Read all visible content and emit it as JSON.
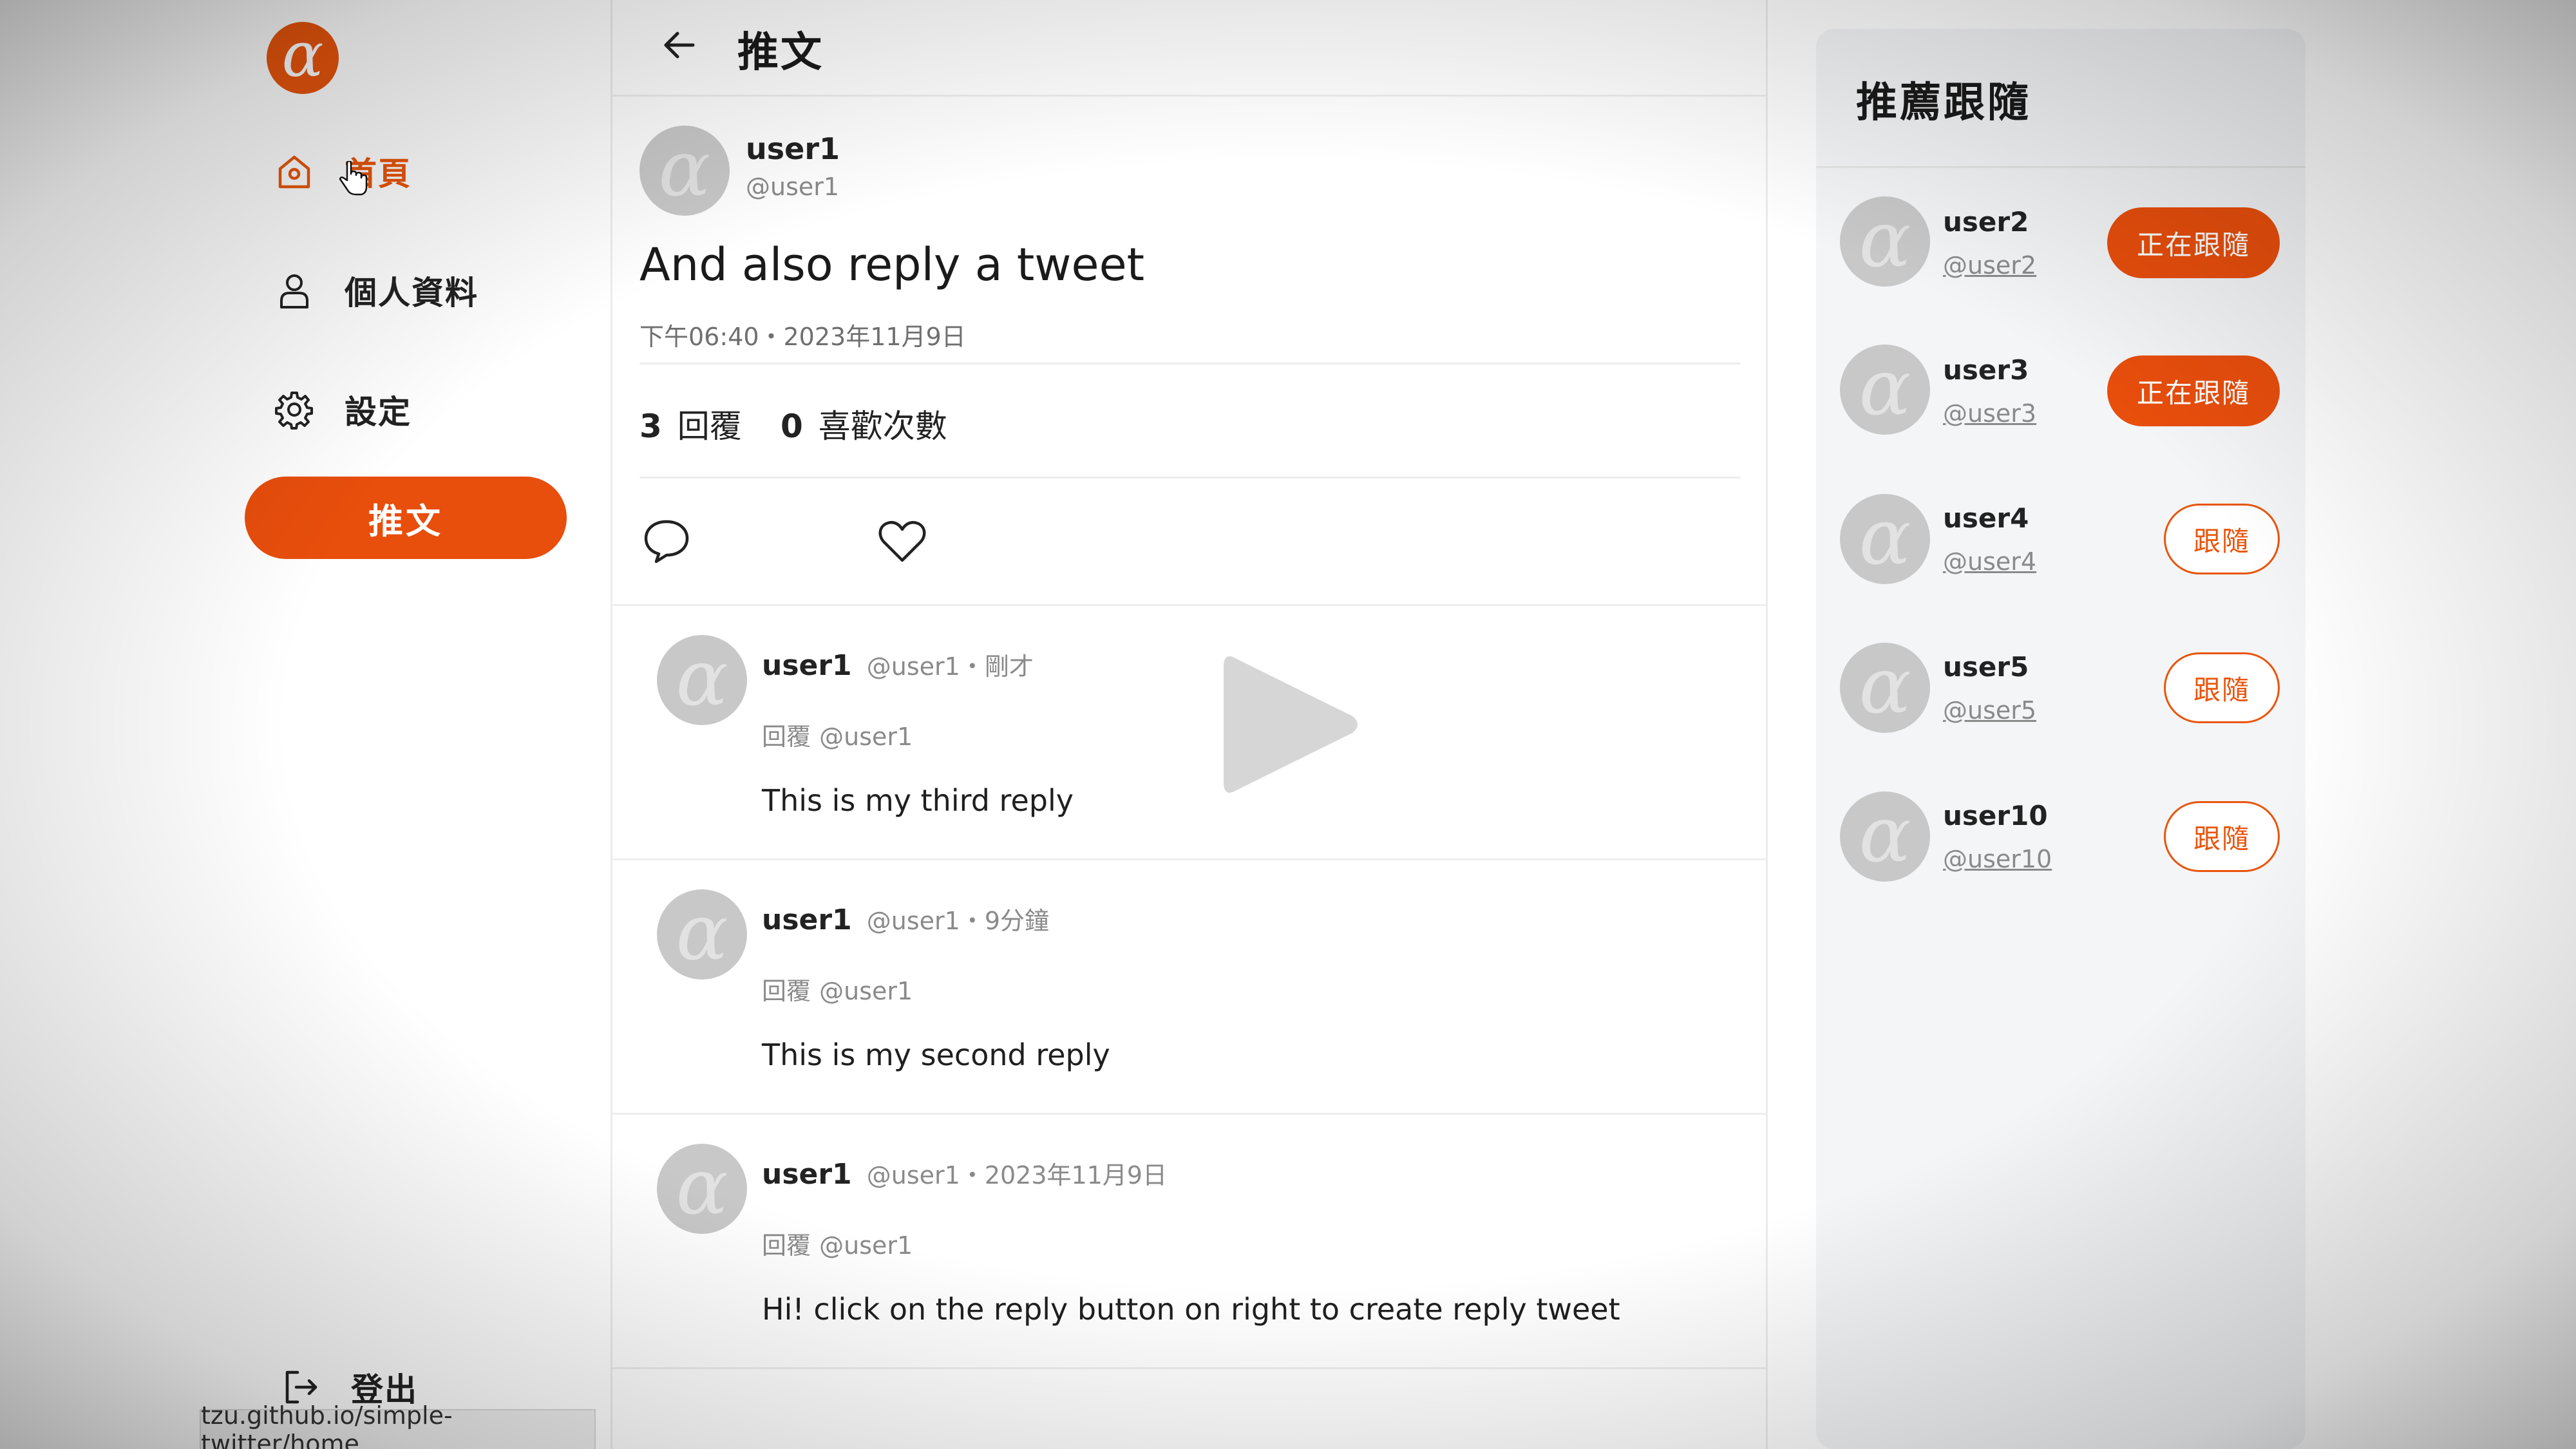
{
  "sidebar": {
    "logo": "alpha-logo-icon",
    "items": [
      {
        "icon": "home-icon",
        "label": "首頁",
        "active": true
      },
      {
        "icon": "user-icon",
        "label": "個人資料",
        "active": false
      },
      {
        "icon": "gear-icon",
        "label": "設定",
        "active": false
      }
    ],
    "tweet_button": "推文",
    "logout": {
      "icon": "logout-icon",
      "label": "登出"
    }
  },
  "header": {
    "back_icon": "arrow-left-icon",
    "title": "推文"
  },
  "tweet": {
    "name": "user1",
    "handle": "@user1",
    "text": "And also reply a tweet",
    "datetime": "下午06:40・2023年11月9日",
    "reply_count": "3",
    "reply_label": "回覆",
    "like_count": "0",
    "like_label": "喜歡次數",
    "reply_icon": "comment-icon",
    "like_icon": "heart-icon"
  },
  "replies": [
    {
      "name": "user1",
      "meta": "@user1・剛才",
      "reply_prefix": "回覆",
      "reply_to": "@user1",
      "text": "This is my third reply"
    },
    {
      "name": "user1",
      "meta": "@user1・9分鐘",
      "reply_prefix": "回覆",
      "reply_to": "@user1",
      "text": "This is my second reply"
    },
    {
      "name": "user1",
      "meta": "@user1・2023年11月9日",
      "reply_prefix": "回覆",
      "reply_to": "@user1",
      "text": "Hi! click on the reply button on right to create reply tweet"
    }
  ],
  "recommend": {
    "title": "推薦跟隨",
    "users": [
      {
        "name": "user2",
        "handle": "@user2",
        "button": "正在跟隨",
        "following": true
      },
      {
        "name": "user3",
        "handle": "@user3",
        "button": "正在跟隨",
        "following": true
      },
      {
        "name": "user4",
        "handle": "@user4",
        "button": "跟隨",
        "following": false
      },
      {
        "name": "user5",
        "handle": "@user5",
        "button": "跟隨",
        "following": false
      },
      {
        "name": "user10",
        "handle": "@user10",
        "button": "跟隨",
        "following": false
      }
    ]
  },
  "status_bar": {
    "url": "tzu.github.io/simple-twitter/home"
  },
  "video_overlay": {
    "icon": "play-icon"
  },
  "colors": {
    "accent": "#e8550c",
    "button_fill": "#e84e0c",
    "avatar": "#c8c8c8"
  }
}
